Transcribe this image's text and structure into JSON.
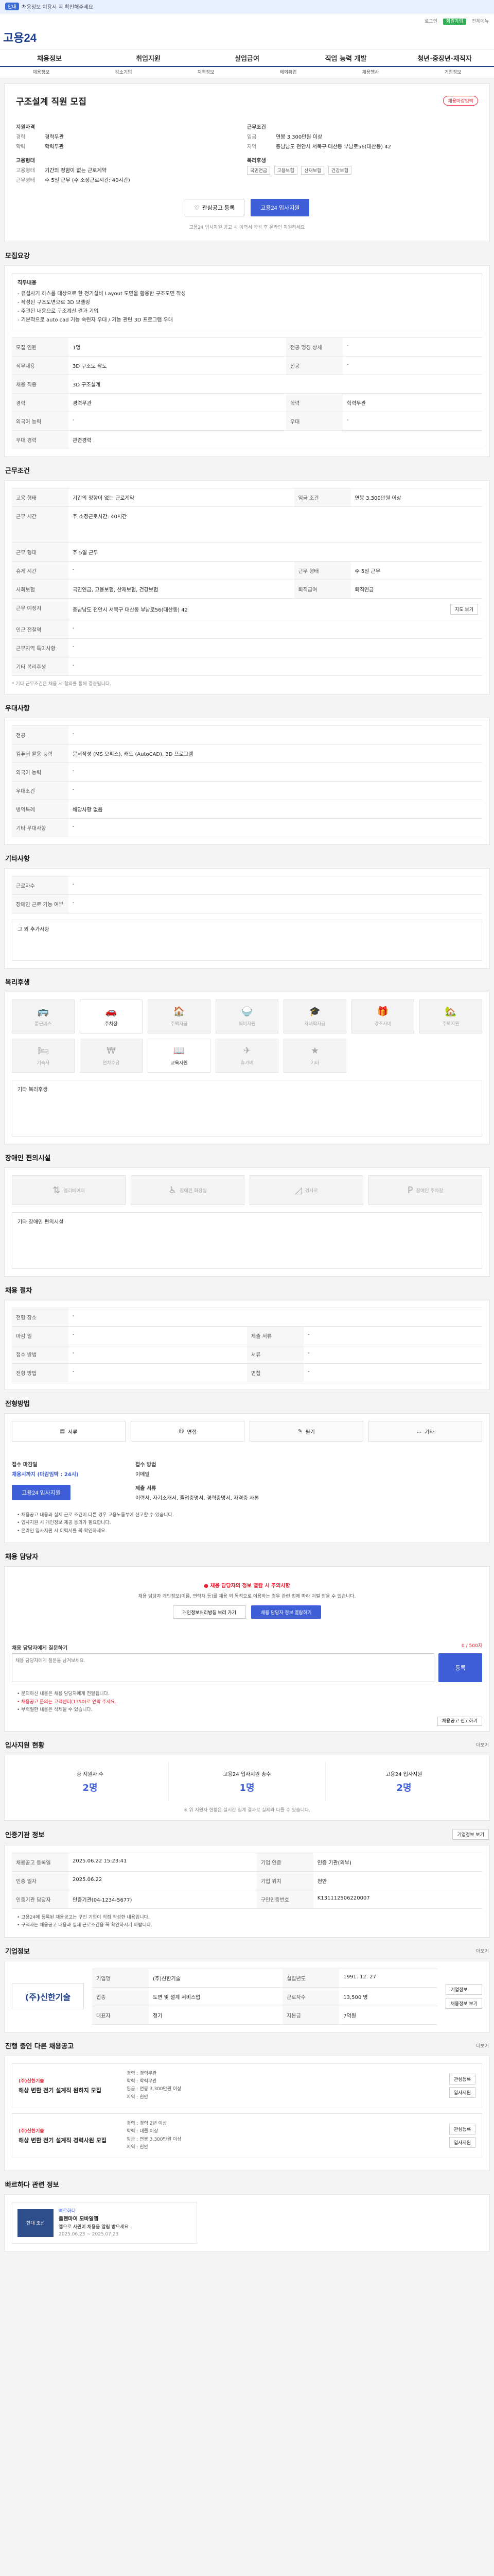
{
  "notice": {
    "pill": "안내",
    "text": "채용정보 이용시 꼭 확인해주세요"
  },
  "header": {
    "logo": "고용24",
    "util": [
      "로그인",
      "회원가입",
      "전체메뉴"
    ]
  },
  "gnb": [
    "채용정보",
    "취업지원",
    "실업급여",
    "직업 능력 개발",
    "청년·중장년·재직자"
  ],
  "subnav": [
    "채용정보",
    "강소기업",
    "지역정보",
    "해외취업",
    "채용행사",
    "기업정보"
  ],
  "job": {
    "title": "구조설계 직원 모집",
    "badge": "채용마감임박",
    "left": {
      "h": "지원자격",
      "items": [
        {
          "k": "경력",
          "v": "경력무관"
        },
        {
          "k": "학력",
          "v": "학력무관"
        }
      ],
      "h2": "고용형태",
      "items2": [
        {
          "k": "고용형태",
          "v": "기간의 정함이 없는 근로계약"
        },
        {
          "k": "근무형태",
          "v": "주 5일 근무 (주 소정근로시간: 40시간)"
        }
      ]
    },
    "right": {
      "h": "근무조건",
      "items": [
        {
          "k": "임금",
          "v": "연봉 3,300만원 이상"
        },
        {
          "k": "지역",
          "v": "충남남도 천안시 서북구 대산동 부남로56(대산동) 42"
        }
      ],
      "h2": "복리후생",
      "tags": [
        "국민연금",
        "고용보험",
        "산재보험",
        "건강보험"
      ]
    },
    "btn_save": "관심공고 등록",
    "btn_apply": "고용24 입사지원",
    "note": "고용24 입사지원 공고 시 이력서 작성 후 온라인 지원하세요"
  },
  "summary": {
    "title": "모집요강",
    "desc_h": "직무내용",
    "desc": [
      "- 유설사기 하스를 대상으로 한 전기설비 Layout 도면을 활용한 구조도면 작성",
      "- 작성된 구조도면으로 3D 모델링",
      "- 주관된 내용으로 구조계산 결과 기입",
      "- 기본적으로 auto cad 기능 숙련자 우대 / 기능 관련 3D 프로그램 우대"
    ],
    "rows": [
      {
        "k": "모집 인원",
        "v": "1명",
        "k2": "전공 명칭 상세",
        "v2": "-"
      },
      {
        "k": "직무내용",
        "v": "3D 구조도 작도",
        "k2": "전공",
        "v2": "-"
      },
      {
        "k": "채용 직종",
        "v": "3D 구조설계",
        "k2": "",
        "v2": ""
      },
      {
        "k": "경력",
        "v": "경력무관",
        "k2": "학력",
        "v2": "학력무관"
      },
      {
        "k": "외국어 능력",
        "v": "-",
        "k2": "우대",
        "v2": "-"
      },
      {
        "k": "우대 경력",
        "v": "관련경력",
        "k2": "",
        "v2": ""
      }
    ]
  },
  "conditions": {
    "title": "근무조건",
    "rows": [
      {
        "k": "고용 형태",
        "v": "기간의 정함이 없는 근로계약",
        "k2": "임금 조건",
        "v2": "연봉 3,300만원 이상"
      },
      {
        "k": "근무 시간",
        "v": "주 소정근로시간: 40시간",
        "k2": "",
        "v2": ""
      },
      {
        "k": "근무 형태",
        "v": "주 5일 근무",
        "k2": "",
        "v2": ""
      },
      {
        "k": "휴게 시간",
        "v": "-",
        "k2": "근무 형태",
        "v2": "주 5일 근무"
      },
      {
        "k": "사회보험",
        "v": "국민연금, 고용보험, 산재보험, 건강보험",
        "k2": "퇴직급여",
        "v2": "퇴직연금"
      },
      {
        "k": "근무 예정지",
        "v": "충남남도 천안시 서북구 대산동 부남로56(대산동) 42",
        "k2": "",
        "v2": ""
      },
      {
        "k": "인근 전철역",
        "v": "-",
        "k2": "",
        "v2": ""
      },
      {
        "k": "근무지역 특이사항",
        "v": "-",
        "k2": "",
        "v2": ""
      },
      {
        "k": "기타 복리후생",
        "v": "-",
        "k2": "",
        "v2": ""
      }
    ],
    "map_btn": "지도 보기",
    "note": "* 기타 근무조건은 채용 시 합의를 통해 결정됩니다."
  },
  "extra": {
    "title": "우대사항",
    "rows": [
      {
        "k": "전공",
        "v": "-"
      },
      {
        "k": "컴퓨터 활용 능력",
        "v": "문서작성 (MS 오피스), 캐드 (AutoCAD), 3D 프로그램"
      },
      {
        "k": "외국어 능력",
        "v": "-"
      },
      {
        "k": "우대조건",
        "v": "-"
      },
      {
        "k": "병역특례",
        "v": "해당사항 없음"
      },
      {
        "k": "기타 우대사항",
        "v": "-"
      }
    ]
  },
  "misc": {
    "title": "기타사항",
    "rows": [
      {
        "k": "근로자수",
        "v": "-"
      },
      {
        "k": "장애인 근로 가능 여부",
        "v": "-"
      }
    ],
    "desc_h": "그 외 추가사항"
  },
  "welfare": {
    "title": "복리후생",
    "items": [
      {
        "label": "통근버스",
        "on": false
      },
      {
        "label": "주차장",
        "on": true
      },
      {
        "label": "주택자금",
        "on": false
      },
      {
        "label": "식비지원",
        "on": false
      },
      {
        "label": "자녀학자금",
        "on": false
      },
      {
        "label": "경조사비",
        "on": false
      },
      {
        "label": "주택지원",
        "on": false
      },
      {
        "label": "기숙사",
        "on": false
      },
      {
        "label": "연차수당",
        "on": false
      },
      {
        "label": "교육지원",
        "on": true
      },
      {
        "label": "휴가비",
        "on": false
      },
      {
        "label": "기타",
        "on": false
      }
    ],
    "other_h": "기타 복리후생"
  },
  "disability": {
    "title": "장애인 편의시설",
    "items": [
      "엘리베이터",
      "장애인 화장실",
      "경사로",
      "장애인 주차장"
    ],
    "other_h": "기타 장애인 편의시설"
  },
  "process": {
    "title": "채용 절차",
    "rows": [
      {
        "k": "전형 장소",
        "v": "-",
        "k2": "",
        "v2": ""
      },
      {
        "k": "마감 일",
        "v": "-",
        "k2": "제출 서류",
        "v2": "-"
      },
      {
        "k": "접수 방법",
        "v": "-",
        "k2": "서류",
        "v2": "-"
      },
      {
        "k": "전형 방법",
        "v": "-",
        "k2": "면접",
        "v2": "-"
      }
    ]
  },
  "apply": {
    "title": "전형방법",
    "methods": [
      {
        "label": "서류",
        "on": true
      },
      {
        "label": "면접",
        "on": true
      },
      {
        "label": "필기",
        "on": false
      },
      {
        "label": "기타",
        "on": false
      }
    ],
    "recv_h": "접수 마감일",
    "recv": "채용시까지 (마감임박 : 24시)",
    "apply_h": "접수 방법",
    "apply_v": "이메일",
    "docs_h": "제출 서류",
    "docs": "이력서, 자기소개서, 졸업증명서, 경력증명서, 자격증 사본",
    "btn": "고용24 입사지원",
    "bullets": [
      "• 채용공고 내용과 실제 근로 조건이 다른 경우 고용노동부에 신고할 수 있습니다.",
      "• 입사지원 시 개인정보 제공 동의가 필요합니다.",
      "• 온라인 입사지원 시 이력서를 꼭 확인하세요."
    ]
  },
  "contact": {
    "title": "채용 담당자",
    "warn": "채용 담당자의 정보 열람 시 주의사항",
    "warn_text": "채용 담당자 개인정보(이름, 연락처 등)를 채용 외 목적으로 이용하는 경우 관련 법에 따라 처벌 받을 수 있습니다.",
    "btn1": "개인정보처리방침 보러 가기",
    "btn2": "채용 담당자 정보 열람하기",
    "qna_h": "채용 담당자에게 질문하기",
    "qna_count": "0 / 500자",
    "qna_placeholder": "채용 담당자에게 질문을 남겨보세요.",
    "qna_btn": "등록",
    "notes": [
      "• 문의하신 내용은 채용 담당자에게 전달됩니다.",
      "• 채용공고 문의는 고객센터(1350)로 연락 주세요.",
      "• 부적절한 내용은 삭제될 수 있습니다."
    ],
    "report_btn": "채용공고 신고하기"
  },
  "stats": {
    "title": "입사지원 현황",
    "more": "더보기",
    "items": [
      {
        "k": "총 지원자 수",
        "v": "2명"
      },
      {
        "k": "고용24 입사지원 총수",
        "v": "1명"
      },
      {
        "k": "고용24 입사지원",
        "v": "2명"
      }
    ],
    "note": "※ 위 지원자 현황은 실시간 집계 결과로 실제와 다를 수 있습니다."
  },
  "info": {
    "title": "인증기관 정보",
    "btn": "기업정보 보기",
    "rows": [
      {
        "k": "채용공고 등록일",
        "v": "2025.06.22 15:23:41",
        "k2": "기업 인증",
        "v2": "인증 기관(외부)"
      },
      {
        "k": "인증 일자",
        "v": "2025.06.22",
        "k2": "기업 위치",
        "v2": "천안"
      },
      {
        "k": "인증기관 담당자",
        "v": "인증기관(04-1234-5677)",
        "k2": "구인인증번호",
        "v2": "K131112506220007"
      }
    ],
    "notes": [
      "• 고용24에 등록된 채용공고는 구인 기업이 직접 작성한 내용입니다.",
      "• 구직자는 채용공고 내용과 실제 근로조건을 꼭 확인하시기 바랍니다."
    ]
  },
  "company": {
    "title": "기업정보",
    "more": "더보기",
    "logo": "(주)신한기술",
    "rows": [
      {
        "k": "기업명",
        "v": "(주)신한기술",
        "k2": "설립년도",
        "v2": "1991. 12. 27"
      },
      {
        "k": "업종",
        "v": "도면 및 설계 서비스업",
        "k2": "근로자수",
        "v2": "13,500 명"
      },
      {
        "k": "대표자",
        "v": "정기",
        "k2": "자본금",
        "v2": "7억원"
      }
    ],
    "btn1": "기업정보",
    "btn2": "채용정보 보기"
  },
  "others": {
    "title": "진행 중인 다른 채용공고",
    "more": "더보기",
    "items": [
      {
        "company": "(주)신한기술",
        "title": "해상 변환 전기 설계직 원하지 모집",
        "lines": [
          "경력 : 경력무관",
          "학력 : 학력무관",
          "임금 : 연봉 3,300만원 이상",
          "지역 : 천안"
        ],
        "b1": "관심등록",
        "b2": "입사지원"
      },
      {
        "company": "(주)신한기술",
        "title": "해상 변환 전기 설계직 경력사원 모집",
        "lines": [
          "경력 : 경력 2년 이상",
          "학력 : 대졸 이상",
          "임금 : 연봉 3,300만원 이상",
          "지역 : 천안"
        ],
        "b1": "관심등록",
        "b2": "입사지원"
      }
    ]
  },
  "recent": {
    "title": "빠르하다 관련 정보",
    "thumb": "현대 조선",
    "label": "빠르하다",
    "name": "플랜마이 모바일앱",
    "desc": "앱으로 사원이 채용을 알림 받으세요",
    "date": "2025.06.23 ~ 2025.07.23"
  }
}
